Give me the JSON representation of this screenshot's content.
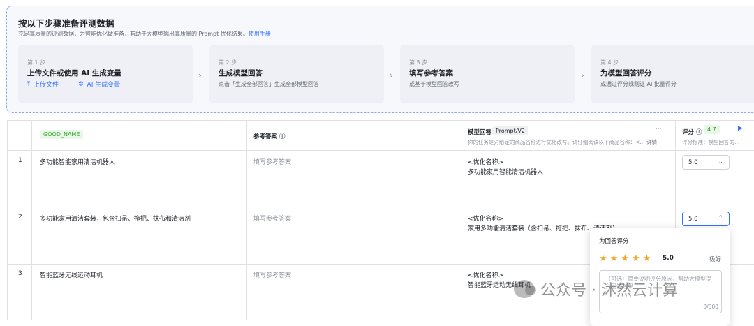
{
  "guide": {
    "title": "按以下步骤准备评测数据",
    "desc": "充足高质量的评测数据，为智能优化做准备，有助于大模型输出高质量的 Prompt 优化结果。",
    "manual_link": "使用手册",
    "steps": [
      {
        "no": "第 1 步",
        "name": "上传文件或使用 AI 生成变量",
        "upload": "上传文件",
        "ai_gen": "AI 生成变量"
      },
      {
        "no": "第 2 步",
        "name": "生成模型回答",
        "sub": "点击「生成全部回答」生成全部模型回答"
      },
      {
        "no": "第 3 步",
        "name": "填写参考答案",
        "sub": "或基于模型回答改写"
      },
      {
        "no": "第 4 步",
        "name": "为模型回答评分",
        "sub": "或通过评分规则让 AI 批量评分"
      }
    ]
  },
  "table": {
    "col_goodname": "GOOD_NAME",
    "col_reference": "参考答案",
    "col_model": "模型回答",
    "model_version": "Prompt/V2",
    "model_desc": "你的任务是对给定的商品名称进行优化改写。请仔细阅读以下商品名称：<…",
    "model_detail": "详情",
    "more": "···",
    "col_score": "评分",
    "score_avg": "4.7",
    "score_desc": "评分标准：模型回答的…",
    "rows": [
      {
        "idx": "1",
        "name": "多功能智能家用清洁机器人",
        "ref": "填写参考答案",
        "ans_tag": "<优化名称>",
        "ans": "多功能家用智能清洁机器人",
        "score": "5.0"
      },
      {
        "idx": "2",
        "name": "多功能家用清洁套装，包含扫帚、拖把、抹布和清洁剂",
        "ref": "填写参考答案",
        "ans_tag": "<优化名称>",
        "ans": "家用多功能清洁套装（含扫帚、拖把、抹布、清洁剂）",
        "score": "5.0"
      },
      {
        "idx": "3",
        "name": "智能蓝牙无线运动耳机",
        "ref": "填写参考答案",
        "ans_tag": "<优化名称>",
        "ans": "智能蓝牙运动无线耳机"
      }
    ]
  },
  "popover": {
    "title": "为回答评分",
    "stars": 5,
    "score": "5.0",
    "grade": "极好",
    "placeholder": "（可选）简要说明评分原因，帮助大模型提升回答效果",
    "count": "0/500"
  },
  "watermark": "公众号 · 沐然云计算",
  "colors": {
    "accent": "#3370ff",
    "tag_green_bg": "#e8f7ea",
    "tag_green_text": "#2ea121",
    "star": "#f5a623"
  }
}
